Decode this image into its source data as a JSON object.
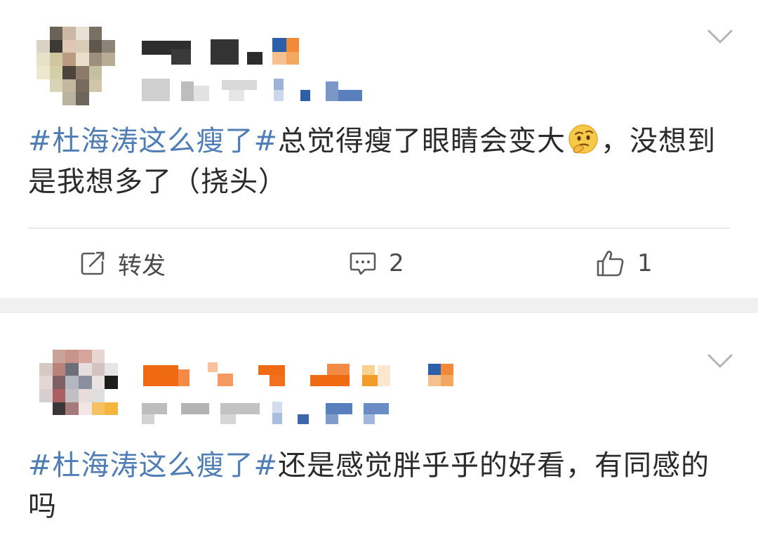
{
  "posts": [
    {
      "hashtag": "#杜海涛这么瘦了#",
      "text_before_emoji": "总觉得瘦了眼睛会变大",
      "emoji": "thinking-face-icon",
      "text_after_emoji": "，没想到是我想多了（挠头）",
      "actions": {
        "repost_label": "转发",
        "comment_count": "2",
        "like_count": "1"
      }
    },
    {
      "hashtag": "#杜海涛这么瘦了#",
      "text": "还是感觉胖乎乎的好看，有同感的吗"
    }
  ],
  "colors": {
    "hashtag": "#4f7db5",
    "separator": "#f0f0f0",
    "text": "#2b2b2b"
  },
  "icons": [
    "chevron-down-icon",
    "repost-icon",
    "comment-icon",
    "like-icon",
    "thinking-face-icon"
  ]
}
